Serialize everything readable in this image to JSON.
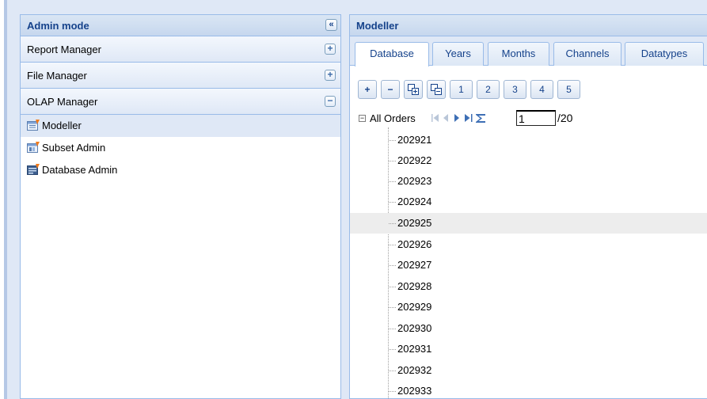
{
  "left_panel": {
    "title": "Admin mode",
    "collapse_glyph": "«",
    "sections": [
      {
        "label": "Report Manager",
        "toggle": "+"
      },
      {
        "label": "File Manager",
        "toggle": "+"
      },
      {
        "label": "OLAP Manager",
        "toggle": "−"
      }
    ],
    "items": [
      {
        "label": "Modeller",
        "icon": "modeller-icon"
      },
      {
        "label": "Subset Admin",
        "icon": "subset-admin-icon"
      },
      {
        "label": "Database Admin",
        "icon": "database-admin-icon"
      }
    ]
  },
  "right_panel": {
    "title": "Modeller",
    "tabs": [
      "Database",
      "Years",
      "Months",
      "Channels",
      "Datatypes"
    ],
    "toolbar": {
      "add": "+",
      "remove": "−",
      "levels": [
        "1",
        "2",
        "3",
        "4",
        "5"
      ]
    },
    "tree": {
      "root_label": "All Orders",
      "page_value": "1",
      "page_total": "/20",
      "rows": [
        "202921",
        "202922",
        "202923",
        "202924",
        "202925",
        "202926",
        "202927",
        "202928",
        "202929",
        "202930",
        "202931",
        "202932",
        "202933"
      ]
    }
  },
  "colors": {
    "header_text": "#15428b",
    "border": "#99bbe8",
    "selected": "#dfe8f6",
    "hover_row": "#ededed"
  }
}
